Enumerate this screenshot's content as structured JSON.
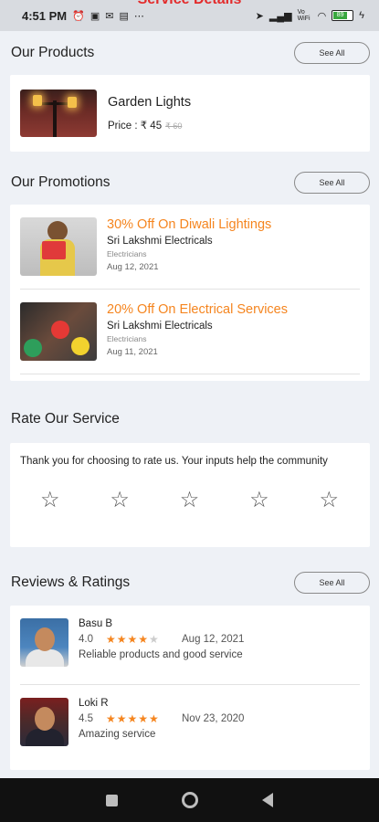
{
  "status_bar": {
    "time": "4:51 PM",
    "peek_title": "Service Details",
    "battery": "89",
    "network": "Vo WiFi"
  },
  "products": {
    "title": "Our Products",
    "see_all": "See All",
    "items": [
      {
        "name": "Garden Lights",
        "price_label": "Price : ₹ 45",
        "old_price": "₹ 60"
      }
    ]
  },
  "promotions": {
    "title": "Our Promotions",
    "see_all": "See All",
    "items": [
      {
        "title": "30% Off On Diwali Lightings",
        "shop": "Sri Lakshmi Electricals",
        "category": "Electricians",
        "date": "Aug 12, 2021"
      },
      {
        "title": "20% Off On Electrical Services",
        "shop": "Sri Lakshmi Electricals",
        "category": "Electricians",
        "date": "Aug 11, 2021"
      }
    ]
  },
  "rate": {
    "title": "Rate Our Service",
    "prompt": "Thank you for choosing to rate us. Your inputs help the community",
    "star_count": 5
  },
  "reviews": {
    "title": "Reviews & Ratings",
    "see_all": "See All",
    "items": [
      {
        "name": "Basu B",
        "rating": "4.0",
        "stars": 4,
        "date": "Aug 12, 2021",
        "text": "Reliable products and good service"
      },
      {
        "name": "Loki R",
        "rating": "4.5",
        "stars": 5,
        "date": "Nov 23, 2020",
        "text": "Amazing service"
      }
    ]
  },
  "colors": {
    "accent_orange": "#f5851f",
    "background": "#eef1f6",
    "header_red": "#e32b2b"
  }
}
